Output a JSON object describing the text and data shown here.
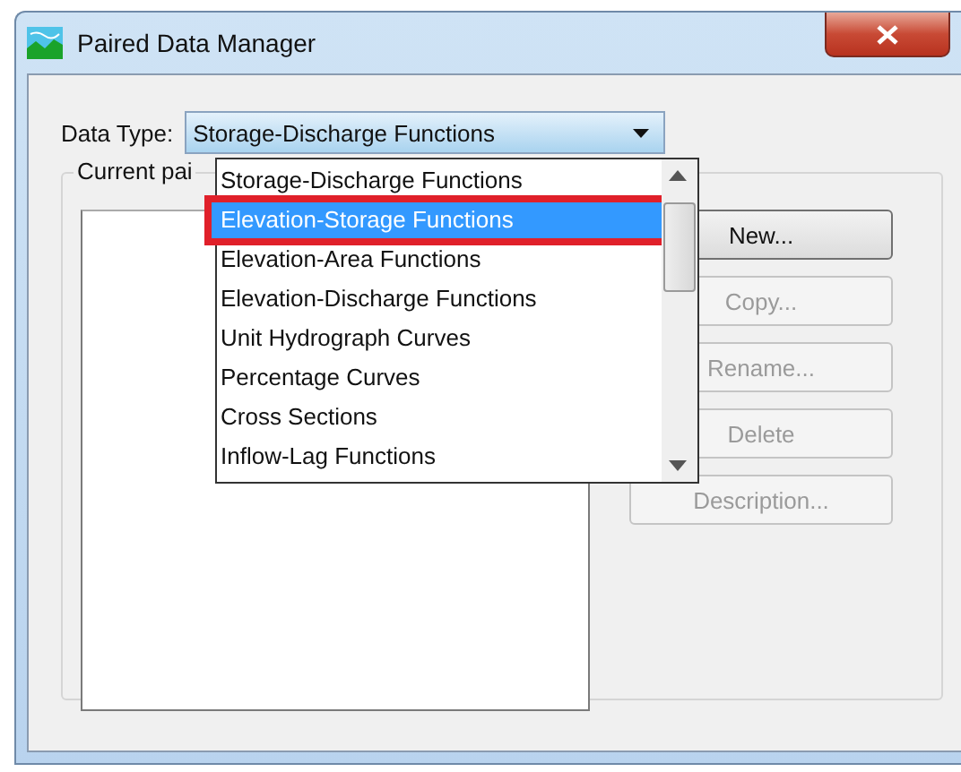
{
  "window": {
    "title": "Paired Data Manager"
  },
  "data_type": {
    "label": "Data Type:",
    "value": "Storage-Discharge Functions"
  },
  "dropdown_items": [
    {
      "label": "Storage-Discharge Functions",
      "selected": false,
      "marked": false
    },
    {
      "label": "Elevation-Storage Functions",
      "selected": true,
      "marked": true
    },
    {
      "label": "Elevation-Area Functions",
      "selected": false,
      "marked": false
    },
    {
      "label": "Elevation-Discharge Functions",
      "selected": false,
      "marked": false
    },
    {
      "label": "Unit Hydrograph Curves",
      "selected": false,
      "marked": false
    },
    {
      "label": "Percentage Curves",
      "selected": false,
      "marked": false
    },
    {
      "label": "Cross Sections",
      "selected": false,
      "marked": false
    },
    {
      "label": "Inflow-Lag Functions",
      "selected": false,
      "marked": false
    }
  ],
  "group": {
    "label": "Current pai"
  },
  "buttons": [
    {
      "label": "New...",
      "disabled": false
    },
    {
      "label": "Copy...",
      "disabled": true
    },
    {
      "label": "Rename...",
      "disabled": true
    },
    {
      "label": "Delete",
      "disabled": true
    },
    {
      "label": "Description...",
      "disabled": true
    }
  ]
}
